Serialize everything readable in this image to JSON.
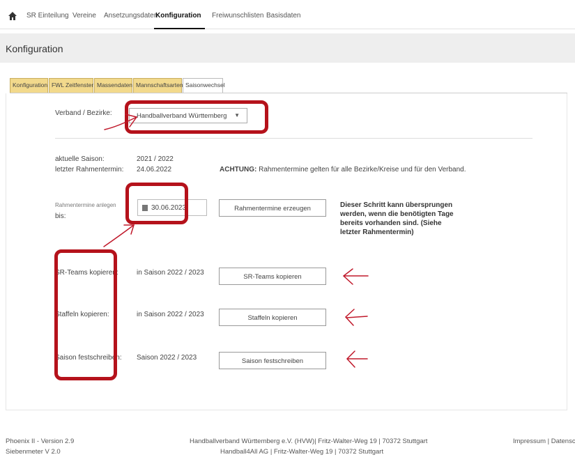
{
  "nav": {
    "items": [
      "SR Einteilung",
      "Vereine",
      "Ansetzungsdaten",
      "Konfiguration",
      "Freiwunschlisten",
      "Basisdaten"
    ],
    "active": "Konfiguration"
  },
  "page": {
    "title": "Konfiguration"
  },
  "tabs": [
    "Konfiguration",
    "FWL Zeitfenster",
    "Massendaten",
    "Mannschaftsarten",
    "Saisonwechsel"
  ],
  "form": {
    "verband_label": "Verband / Bezirke:",
    "verband_value": "Handballverband Württemberg",
    "season_label": "aktuelle Saison:",
    "season_value": "2021 / 2022",
    "last_date_label": "letzter Rahmentermin:",
    "last_date_value": "24.06.2022",
    "warning_bold": "ACHTUNG:",
    "warning_text": "Rahmentermine gelten für alle Bezirke/Kreise und für den Verband.",
    "create_label_1": "Rahmentermine anlegen",
    "create_label_2": "bis:",
    "create_date": "30.06.2023",
    "create_button": "Rahmentermine erzeugen",
    "note": "Dieser Schritt kann übersprungen werden, wenn die benötigten Tage bereits vorhanden sind. (Siehe letzter Rahmentermin)",
    "teams_label": "SR-Teams kopieren:",
    "teams_value": "in Saison 2022 / 2023",
    "teams_button": "SR-Teams kopieren",
    "staffeln_label": "Staffeln kopieren:",
    "staffeln_value": "in Saison 2022 / 2023",
    "staffeln_button": "Staffeln kopieren",
    "fest_label": "Saison festschreiben:",
    "fest_value": "Saison 2022 / 2023",
    "fest_button": "Saison festschreiben"
  },
  "footer": {
    "version_1": "Phoenix II - Version 2.9",
    "version_2": "Siebenmeter V 2.0",
    "org_1": "Handballverband Württemberg e.V. (HVW)| Fritz-Walter-Weg 19 | 70372 Stuttgart",
    "org_2": "Handball4All AG | Fritz-Walter-Weg 19 | 70372 Stuttgart",
    "links": "Impressum | Datenschut"
  },
  "colors": {
    "annotation": "#b5121b",
    "tab_bg": "#f2d98c",
    "title_bar": "#eeeeee"
  }
}
